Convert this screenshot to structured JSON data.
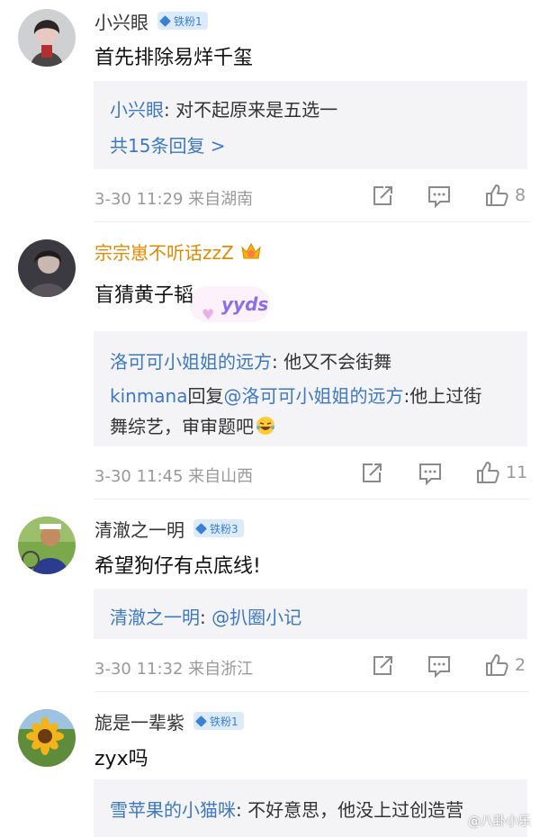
{
  "comments": [
    {
      "username": "小兴眼",
      "badge": "铁粉1",
      "content": "首先排除易烊千玺",
      "replies": [
        {
          "name": "小兴眼",
          "text": ": 对不起原来是五选一"
        }
      ],
      "more": "共15条回复 >",
      "meta": "3-30 11:29  来自湖南",
      "likes": "8",
      "icons": [
        "share-icon",
        "comment-icon",
        "like-icon"
      ]
    },
    {
      "username": "宗宗崽不听话zzZ",
      "username_color": "#e08a00",
      "content": "盲猜黄子韬",
      "sticker": "yyds",
      "replies": [
        {
          "name": "洛可可小姐姐的远方",
          "text": ": 他又不会街舞"
        },
        {
          "name": "kinmana",
          "text": "回复",
          "mention": "@洛可可小姐姐的远方",
          "text2": ":他上过街"
        },
        {
          "text": "舞综艺，审审题吧"
        }
      ],
      "meta": "3-30 11:45  来自山西",
      "likes": "11"
    },
    {
      "username": "清澈之一明",
      "badge": "铁粉3",
      "content": "希望狗仔有点底线!",
      "replies": [
        {
          "name": "清澈之一明",
          "text": ": ",
          "mention": "@扒圈小记"
        }
      ],
      "meta": "3-30 11:32  来自浙江",
      "likes": "2"
    },
    {
      "username": "旎是一辈紫",
      "badge": "铁粉1",
      "content": "zyx吗",
      "replies": [
        {
          "name": "雪苹果的小猫咪",
          "text": ": 不好意思，他没上过创造营"
        }
      ]
    }
  ],
  "watermark": "@八卦小乐",
  "colors": {
    "link": "#3d78c4",
    "badge_bg": "#dcebfa",
    "badge_text": "#3b7fd6",
    "meta": "#999999",
    "reply_bg": "#f4f4f6"
  }
}
